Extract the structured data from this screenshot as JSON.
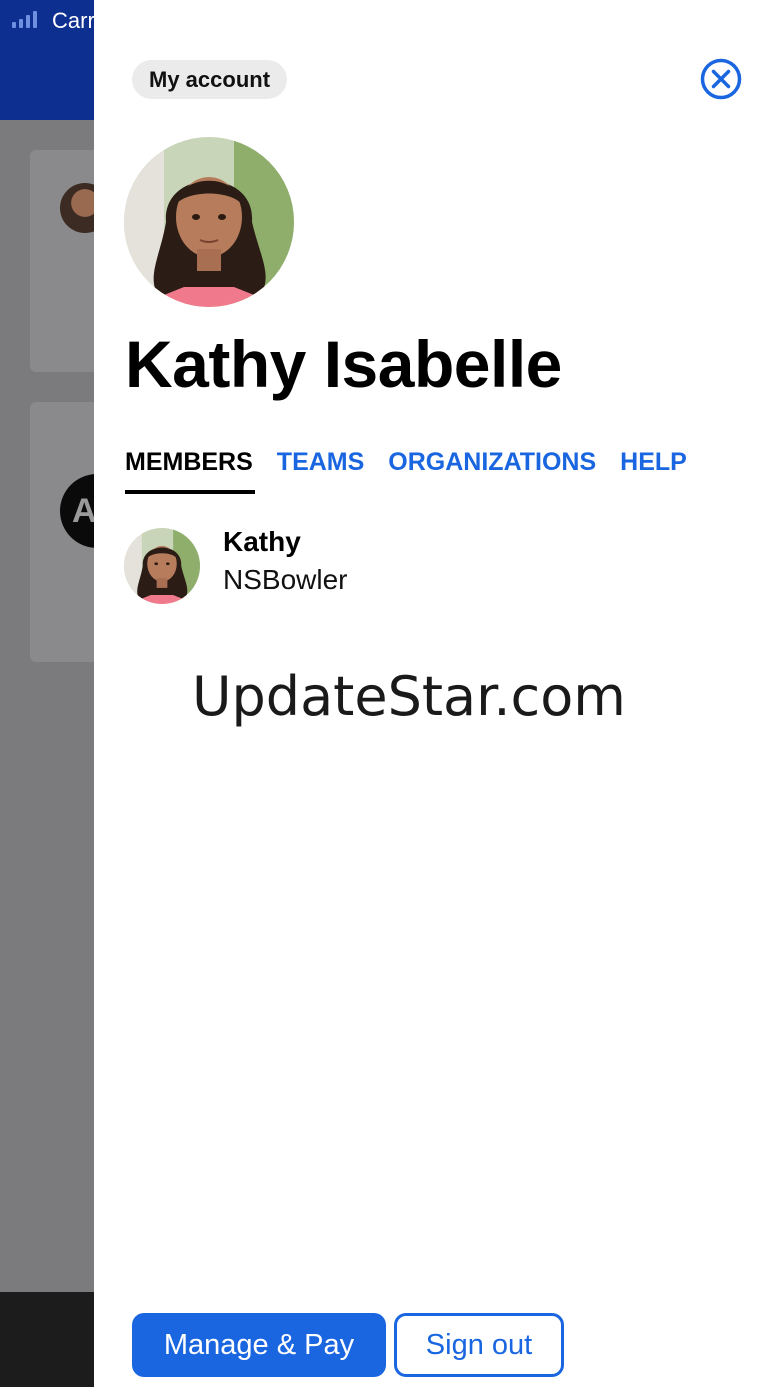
{
  "status_bar": {
    "carrier": "Carr"
  },
  "background": {
    "avatar_initial": "A"
  },
  "panel": {
    "account_chip": "My account",
    "close_icon": "close-circle-icon",
    "profile_name": "Kathy Isabelle",
    "tabs": [
      {
        "label": "MEMBERS",
        "active": true
      },
      {
        "label": "TEAMS",
        "active": false
      },
      {
        "label": "ORGANIZATIONS",
        "active": false
      },
      {
        "label": "HELP",
        "active": false
      }
    ],
    "members": [
      {
        "name": "Kathy",
        "role": "NSBowler"
      }
    ],
    "watermark": "UpdateStar.com",
    "buttons": {
      "manage_pay": "Manage & Pay",
      "sign_out": "Sign out"
    }
  },
  "colors": {
    "accent": "#1a66e0",
    "header": "#0d2f8f",
    "overlay": "#7b7b7d"
  }
}
